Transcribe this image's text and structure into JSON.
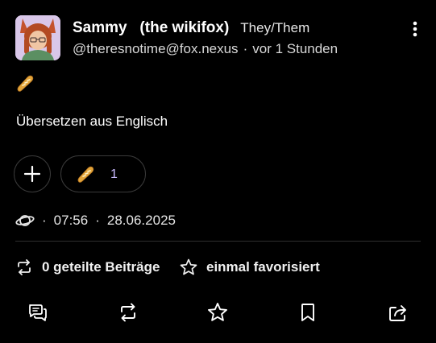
{
  "post": {
    "author": {
      "display_name": "Sammy   (the wikifox)",
      "pronouns": "They/Them",
      "handle": "@theresnotime@fox.nexus",
      "separator": "·",
      "relative_time": "vor 1 Stunden"
    },
    "content_emoji": "baguette-emoji",
    "translate_label": "Übersetzen aus Englisch",
    "reactions": [
      {
        "emoji": "baguette-emoji",
        "count": "1"
      }
    ],
    "meta": {
      "visibility_icon": "planet-icon",
      "dot": "·",
      "time": "07:56",
      "date": "28.06.2025"
    },
    "stats": {
      "boosts_label": "0 geteilte Beiträge",
      "favourites_label": "einmal favorisiert"
    },
    "actions": [
      "reply",
      "boost",
      "favourite",
      "bookmark",
      "share"
    ],
    "colors": {
      "background": "#000000",
      "text": "#ffffff",
      "reaction_count": "#c9bbff",
      "border": "#3a3a3a"
    }
  }
}
